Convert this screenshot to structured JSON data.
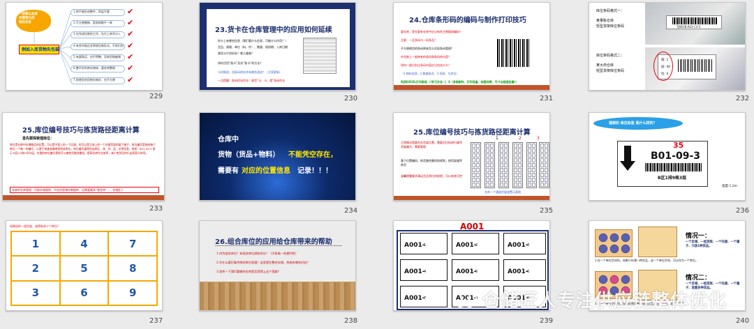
{
  "watermark": "仓储匠人专注供应链整体优化",
  "slides": [
    {
      "number": "229",
      "center_label": "一放管以品库\n存管理与控\n制的关系",
      "left_label": "例如入库货物先包装",
      "branches": [
        "1.除不能形成整件、垛层不要",
        "2.不方便搬移、容易掉散不一致",
        "3.先完成包装的工作，先付上库并计入",
        "4.有些时候还非常规包装形式，不易识别",
        "5.有要购买，也不得整，导致货物越储",
        "6.整不好的库存物体，要补库整理",
        "7.即便货的货物包装好，也不方便"
      ]
    },
    {
      "number": "230",
      "title": "23.货卡在仓库管理中的应用如何延续",
      "bullets": [
        "你卡上有哪些信息（我们看什么信息，可能什么作用？）",
        "货品、规格、单位（料、件）、数量、保质期、入库日期",
        "使用卡片的好处？哪儿难做？",
        "如何活用“账卡”及实“账卡”的方法？",
        "与时俱进，用条码的技术有哪些改进？（方案更新）",
        "一点提醒：条码优化作业：收货“卡、卡、相”条码作业"
      ]
    },
    {
      "number": "231",
      "title": "24.仓库条形码的编码与制作打印技巧",
      "bullets": [
        "要仓库，是先要有仓库中应当有的主数据和编码？",
        "注意：一品多码与一码多品？",
        "不方便使用的条码原来怎么实现条码管理？",
        "外包装上一般带有的条码和条码的内容？",
        "如何一般识别过条码内容应当包含什么？",
        "（1.物料信息、2.数量批次、3.包装、4.库位）"
      ],
      "footer": "利用EXCEL打印条码（（学习方法（）3（多码制作、打印设备、标签材质、尺寸与相适应度））"
    },
    {
      "number": "232",
      "format1_heading": "库位条码格式一：",
      "format1_text": "某量贩仓库\n轻型货架库位条码",
      "format2_heading": "库位条码格式二：",
      "format2_text": "某大商仓库\n轻型货架库位条码",
      "label1": "TJAB1B-A03-C3-5",
      "label2_rows": [
        "排: 1",
        "层: 40",
        "位: 4"
      ]
    },
    {
      "number": "233",
      "title": "25.库位编号技巧与拣货路径距离计算",
      "subtitle": "首先要探索理库位：",
      "body": "库位是仓库中存储物品的位置，可以是平面上的一个区域，也可以是立体上的一个存储货架的某个格子。库位编号是指给每个库位一个唯一的编号，以便于快速准确地找到该库位。库位编号通常包括库区、排、列、层、位等信息，例如：B01-09-3 表示 B区01排09列3层。合理的库位编号规则可以使拣货路径最短，提高仓库作业效率，减少拣货员的行走距离与时间。",
      "note": "未来的仓库管理，目前存储规划，不仅仅是储存数据库，还需要最多“稳定库”……仓储匠人"
    },
    {
      "number": "234",
      "line1": "仓库中",
      "line2a": "货物（货品+物料）",
      "line2b": "不能凭空存在，",
      "line3a": "需要有",
      "line3b": "对应的位置信息",
      "line3c": "记录！！！"
    },
    {
      "number": "235",
      "title": "25.库位编号技巧与拣货路径距离计算",
      "bullets": [
        "正常情况是要在存货架位置，需要对位料进行顺序货架编号，需要管理",
        "基于位置编码，拣货路径最短地规划，按货架顺序拣货",
        "温馨提醒要求满足货品到位的前提，可以有效可控"
      ],
      "rack_numbers": [
        "1",
        "2",
        "3"
      ],
      "caption": "仓库一个通道货架放置示意图"
    },
    {
      "number": "236",
      "bubble": "理想的 库位标签 是什么样的？",
      "top_num": "35",
      "code": "B01-09-3",
      "desc": "B区1排9格3层",
      "width_note": "宽度:1.2m"
    },
    {
      "number": "237",
      "question": "如果这样一组货架，该得有多少个库位？",
      "cells": [
        "1",
        "4",
        "7",
        "2",
        "5",
        "8",
        "3",
        "6",
        "9"
      ]
    },
    {
      "number": "238",
      "title": "26.组合库位的应用给仓库带来的帮助",
      "items": [
        "1.何为组合库位？有组合库位就有所分？（大拆装一些便利性）",
        "2.为什么要打破传统的库位思维？这里是在整合存储，到底有哪些好处？",
        "3.思考一下我们要做的仓库是否用得上这个思路？"
      ]
    },
    {
      "number": "239",
      "header": "A001",
      "boxes": [
        {
          "label": "A001-",
          "suffix": "1"
        },
        {
          "label": "A001-",
          "suffix": "2"
        },
        {
          "label": "A001-",
          "suffix": "3"
        },
        {
          "label": "A001-",
          "suffix": "4"
        },
        {
          "label": "A001-",
          "suffix": "5"
        },
        {
          "label": "A001-",
          "suffix": "6"
        },
        {
          "label": "A001-",
          "suffix": "7"
        },
        {
          "label": "A001-",
          "suffix": "8"
        },
        {
          "label": "A001-",
          "suffix": "9"
        }
      ]
    },
    {
      "number": "240",
      "case1_title": "情况一：",
      "case1_text": "一个区域、一组货架、一个托盘、一个箱子、只放1种货品。",
      "case1_caption": "1.在一个单位空间内，如果只存储一种货品，这一个单位空间，可以作为一个库位。",
      "case2_title": "情况二：",
      "case2_text": "一个区域、一组货架、一个托盘、一个箱子、放置多种货品。",
      "case2_caption": "2.在一个单位空间内，如果存储多种不同的货品，这个空间，这两种货品......"
    }
  ]
}
